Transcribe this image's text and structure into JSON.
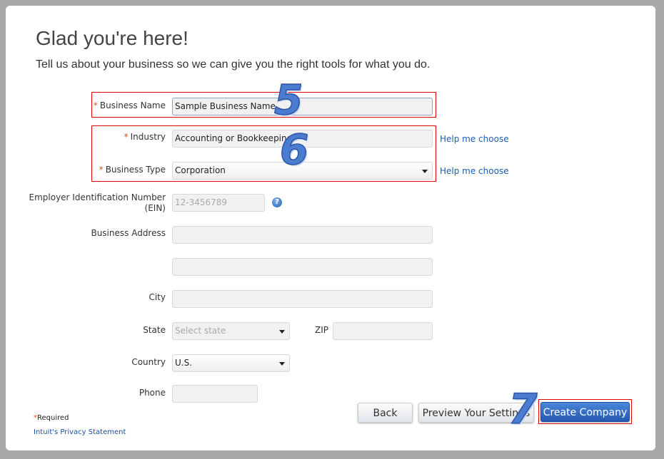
{
  "title": "Glad you're here!",
  "subtitle": "Tell us about your business so we can give you the right tools for what you do.",
  "fields": {
    "business_name": {
      "label": "Business Name",
      "value": "Sample Business Name"
    },
    "industry": {
      "label": "Industry",
      "value": "Accounting or Bookkeeping",
      "help": "Help me choose"
    },
    "business_type": {
      "label": "Business Type",
      "value": "Corporation",
      "help": "Help me choose"
    },
    "ein": {
      "label": "Employer Identification Number (EIN)",
      "placeholder": "12-3456789"
    },
    "address": {
      "label": "Business Address"
    },
    "city": {
      "label": "City"
    },
    "state": {
      "label": "State",
      "placeholder": "Select state"
    },
    "zip": {
      "label": "ZIP"
    },
    "country": {
      "label": "Country",
      "value": "U.S."
    },
    "phone": {
      "label": "Phone"
    }
  },
  "required_mark": "*",
  "required_note": "Required",
  "privacy": "Intuit's Privacy Statement",
  "buttons": {
    "back": "Back",
    "preview": "Preview Your Settings",
    "create": "Create Company"
  },
  "annotations": {
    "a5": "5",
    "a6": "6",
    "a7": "7"
  },
  "colors": {
    "accent": "#2f66c0",
    "highlight": "#e00000"
  }
}
